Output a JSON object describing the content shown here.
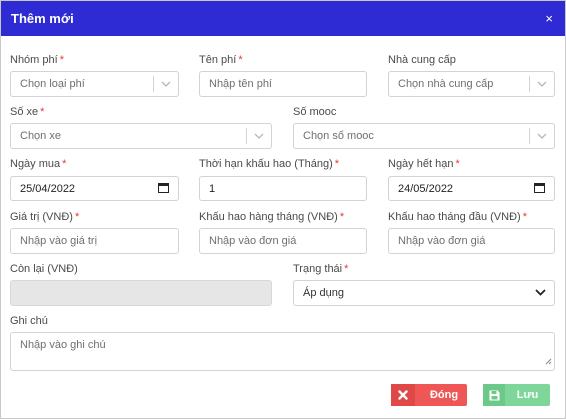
{
  "modal": {
    "title": "Thêm mới",
    "close_glyph": "×"
  },
  "fields": {
    "fee_group": {
      "label": "Nhóm phí",
      "required": "*",
      "placeholder": "Chọn loại phí"
    },
    "fee_name": {
      "label": "Tên phí",
      "required": "*",
      "placeholder": "Nhập tên phí"
    },
    "supplier": {
      "label": "Nhà cung cấp",
      "placeholder": "Chọn nhà cung cấp"
    },
    "vehicle_no": {
      "label": "Số xe",
      "required": "*",
      "placeholder": "Chọn xe"
    },
    "trailer_no": {
      "label": "Số mooc",
      "placeholder": "Chọn số mooc"
    },
    "purchase_date": {
      "label": "Ngày mua",
      "required": "*",
      "value": "25/04/2022"
    },
    "depreciation_term": {
      "label": "Thời hạn khấu hao (Tháng)",
      "required": "*",
      "value": "1"
    },
    "expiry_date": {
      "label": "Ngày hết hạn",
      "required": "*",
      "value": "24/05/2022"
    },
    "value_vnd": {
      "label": "Giá trị (VNĐ)",
      "required": "*",
      "placeholder": "Nhập vào giá trị"
    },
    "monthly_depreciation": {
      "label": "Khấu hao hàng tháng (VNĐ)",
      "required": "*",
      "placeholder": "Nhập vào đơn giá"
    },
    "first_month_depreciation": {
      "label": "Khấu hao tháng đầu (VNĐ)",
      "required": "*",
      "placeholder": "Nhập vào đơn giá"
    },
    "remaining_vnd": {
      "label": "Còn lại (VNĐ)",
      "value": ""
    },
    "status": {
      "label": "Trạng thái",
      "required": "*",
      "value": "Áp dụng"
    },
    "note": {
      "label": "Ghi chú",
      "placeholder": "Nhập vào ghi chú"
    }
  },
  "buttons": {
    "close": "Đóng",
    "save": "Lưu"
  },
  "colors": {
    "header": "#2f2bd4",
    "close_button": "#ef5757",
    "save_button": "#7fd69a",
    "required": "#e53935"
  }
}
